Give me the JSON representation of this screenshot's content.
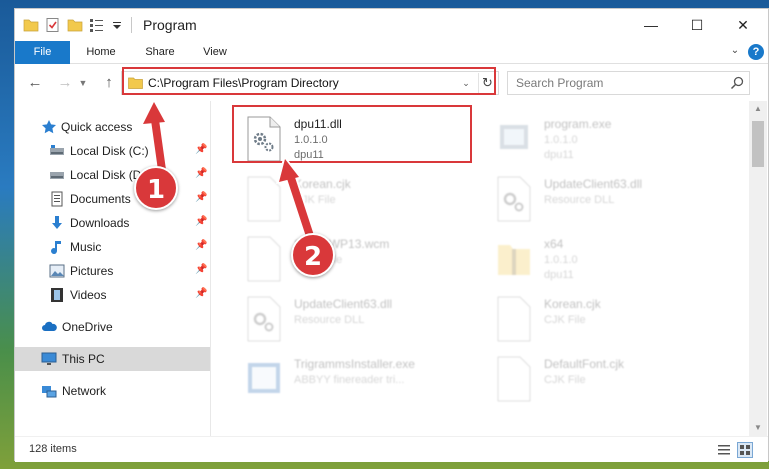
{
  "window": {
    "title": "Program",
    "minimize_glyph": "—",
    "maximize_glyph": "☐",
    "close_glyph": "✕"
  },
  "ribbon": {
    "tabs": [
      {
        "label": "File"
      },
      {
        "label": "Home"
      },
      {
        "label": "Share"
      },
      {
        "label": "View"
      }
    ],
    "help_glyph": "?"
  },
  "nav": {
    "back_glyph": "←",
    "forward_glyph": "→",
    "up_glyph": "↑",
    "address": "C:\\Program Files\\Program Directory",
    "search_placeholder": "Search Program"
  },
  "sidebar": {
    "items": [
      {
        "label": "Quick access",
        "icon": "star-icon",
        "pinned": false
      },
      {
        "label": "Local Disk (C:)",
        "icon": "drive-icon",
        "pinned": true
      },
      {
        "label": "Local Disk (D:)",
        "icon": "drive-icon",
        "pinned": true
      },
      {
        "label": "Documents",
        "icon": "documents-icon",
        "pinned": true
      },
      {
        "label": "Downloads",
        "icon": "download-icon",
        "pinned": true
      },
      {
        "label": "Music",
        "icon": "music-icon",
        "pinned": true
      },
      {
        "label": "Pictures",
        "icon": "pictures-icon",
        "pinned": true
      },
      {
        "label": "Videos",
        "icon": "videos-icon",
        "pinned": true
      },
      {
        "label": "OneDrive",
        "icon": "cloud-icon",
        "pinned": false
      },
      {
        "label": "This PC",
        "icon": "computer-icon",
        "pinned": false,
        "selected": true
      },
      {
        "label": "Network",
        "icon": "network-icon",
        "pinned": false
      }
    ]
  },
  "files": [
    {
      "name": "dpu11.dll",
      "line2": "1.0.1.0",
      "line3": "dpu11",
      "icon": "dll-gear-icon",
      "highlighted": true
    },
    {
      "name": "program.exe",
      "line2": "1.0.1.0",
      "line3": "dpu11",
      "icon": "exe-icon"
    },
    {
      "name": "Korean.cjk",
      "line2": "CJK File",
      "line3": "",
      "icon": "blank-file-icon"
    },
    {
      "name": "UpdateClient63.dll",
      "line2": "Resource DLL",
      "line3": "",
      "icon": "dll-gear-icon"
    },
    {
      "name": "SnaggWP13.wcm",
      "line2": "WCM File",
      "line3": "",
      "icon": "blank-file-icon"
    },
    {
      "name": "x64",
      "line2": "1.0.1.0",
      "line3": "dpu11",
      "icon": "folder-zip-icon"
    },
    {
      "name": "UpdateClient63.dll",
      "line2": "Resource DLL",
      "line3": "",
      "icon": "dll-gear-icon"
    },
    {
      "name": "Korean.cjk",
      "line2": "CJK File",
      "line3": "",
      "icon": "blank-file-icon"
    },
    {
      "name": "TrigrammsInstaller.exe",
      "line2": "ABBYY finereader tri...",
      "line3": "",
      "icon": "installer-icon"
    },
    {
      "name": "DefaultFont.cjk",
      "line2": "CJK File",
      "line3": "",
      "icon": "blank-file-icon"
    }
  ],
  "status": {
    "item_count": "128 items"
  },
  "annotations": {
    "step1": "1",
    "step2": "2",
    "color": "#d9383a"
  },
  "colors": {
    "accent": "#1979ca",
    "highlight": "#d9383a",
    "folder": "#f2c94c"
  }
}
